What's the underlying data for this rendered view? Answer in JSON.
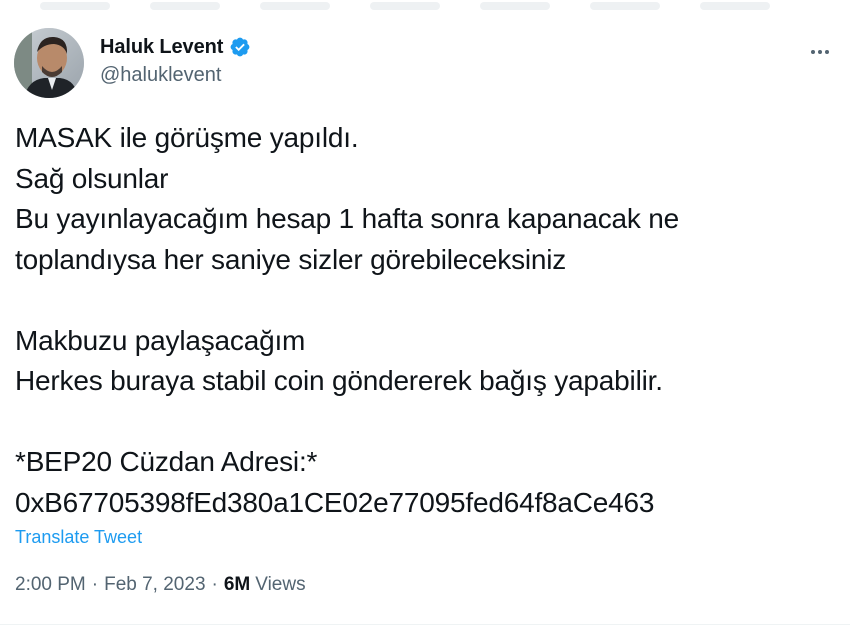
{
  "tweet": {
    "author": {
      "display_name": "Haluk Levent",
      "handle": "@haluklevent",
      "verified": true,
      "avatar_icon": "profile-photo",
      "verified_icon": "verified-badge-icon",
      "verified_color": "#1d9bf0"
    },
    "more_icon": "more-horizontal-icon",
    "text_lines": [
      "MASAK ile görüşme yapıldı.",
      "Sağ olsunlar",
      "Bu yayınlayacağım hesap 1 hafta sonra kapanacak ne",
      "toplandıysa her saniye sizler görebileceksiniz",
      "",
      "Makbuzu paylaşacağım",
      "Herkes buraya stabil coin göndererek bağış yapabilir.",
      "",
      "*BEP20 Cüzdan Adresi:*",
      "0xB67705398fEd380a1CE02e77095fed64f8aCe463"
    ],
    "translate_label": "Translate Tweet",
    "time": "2:00 PM",
    "separator": "·",
    "date": "Feb 7, 2023",
    "views_count": "6M",
    "views_label": "Views"
  },
  "colors": {
    "text": "#0f1419",
    "secondary": "#536471",
    "link": "#1d9bf0",
    "divider": "#eff3f4"
  }
}
